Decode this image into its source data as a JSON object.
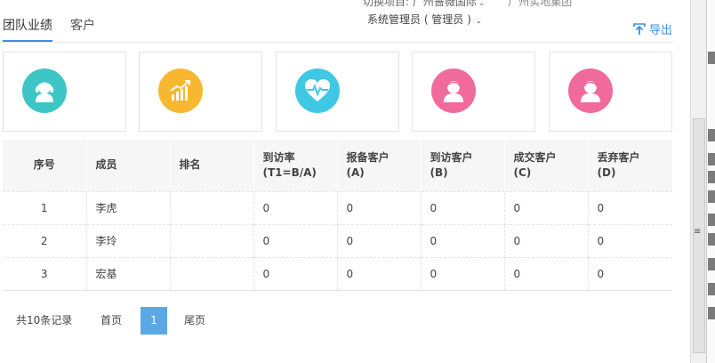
{
  "header": {
    "project_prefix": "切换项目:",
    "project_name": "广州蔷薇国际",
    "group_name": "广州实地集团",
    "user": "系统管理员 ( 管理员 )"
  },
  "tabs": [
    {
      "label": "团队业绩",
      "active": true
    },
    {
      "label": "客户",
      "active": false
    }
  ],
  "export_label": "导出",
  "cards": [
    {
      "icon": "person-headset-icon",
      "color": "#3ec5c5"
    },
    {
      "icon": "growth-chart-icon",
      "color": "#f7b731"
    },
    {
      "icon": "heart-pulse-icon",
      "color": "#3fc8e4"
    },
    {
      "icon": "person-icon",
      "color": "#f16a9c"
    },
    {
      "icon": "person-icon",
      "color": "#f16a9c"
    }
  ],
  "table": {
    "headers": [
      {
        "line1": "序号",
        "line2": ""
      },
      {
        "line1": "成员",
        "line2": ""
      },
      {
        "line1": "排名",
        "line2": ""
      },
      {
        "line1": "到访率",
        "line2": "(T1=B/A)"
      },
      {
        "line1": "报备客户",
        "line2": "(A)"
      },
      {
        "line1": "到访客户",
        "line2": "(B)"
      },
      {
        "line1": "成交客户",
        "line2": "(C)"
      },
      {
        "line1": "丢弃客户",
        "line2": "(D)"
      }
    ],
    "rows": [
      {
        "idx": "1",
        "member": "李虎",
        "rank": "",
        "rate": "0",
        "a": "0",
        "b": "0",
        "c": "0",
        "d": "0"
      },
      {
        "idx": "2",
        "member": "李玲",
        "rank": "",
        "rate": "0",
        "a": "0",
        "b": "0",
        "c": "0",
        "d": "0"
      },
      {
        "idx": "3",
        "member": "宏基",
        "rank": "",
        "rate": "0",
        "a": "0",
        "b": "0",
        "c": "0",
        "d": "0"
      }
    ]
  },
  "pager": {
    "total": "共10条记录",
    "first": "首页",
    "current": "1",
    "last": "尾页"
  },
  "colors": {
    "accent": "#3a8ee6",
    "page_active": "#5aa9e6"
  }
}
